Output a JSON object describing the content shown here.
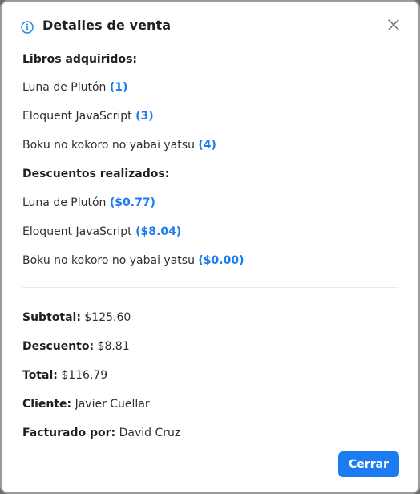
{
  "modal": {
    "title": "Detalles de venta",
    "close_label": "×",
    "accent_color": "#1a7cf0"
  },
  "books": {
    "heading": "Libros adquiridos:",
    "items": [
      {
        "name": "Luna de Plutón",
        "qty": "(1)"
      },
      {
        "name": "Eloquent JavaScript",
        "qty": "(3)"
      },
      {
        "name": "Boku no kokoro no yabai yatsu",
        "qty": "(4)"
      }
    ]
  },
  "discounts": {
    "heading": "Descuentos realizados:",
    "items": [
      {
        "name": "Luna de Plutón",
        "amount": "($0.77)"
      },
      {
        "name": "Eloquent JavaScript",
        "amount": "($8.04)"
      },
      {
        "name": "Boku no kokoro no yabai yatsu",
        "amount": "($0.00)"
      }
    ]
  },
  "summary": {
    "subtotal_label": "Subtotal:",
    "subtotal_value": "$125.60",
    "discount_label": "Descuento:",
    "discount_value": "$8.81",
    "total_label": "Total:",
    "total_value": "$116.79",
    "client_label": "Cliente:",
    "client_value": "Javier Cuellar",
    "billed_label": "Facturado por:",
    "billed_value": "David Cruz"
  },
  "footer": {
    "close_button": "Cerrar"
  }
}
